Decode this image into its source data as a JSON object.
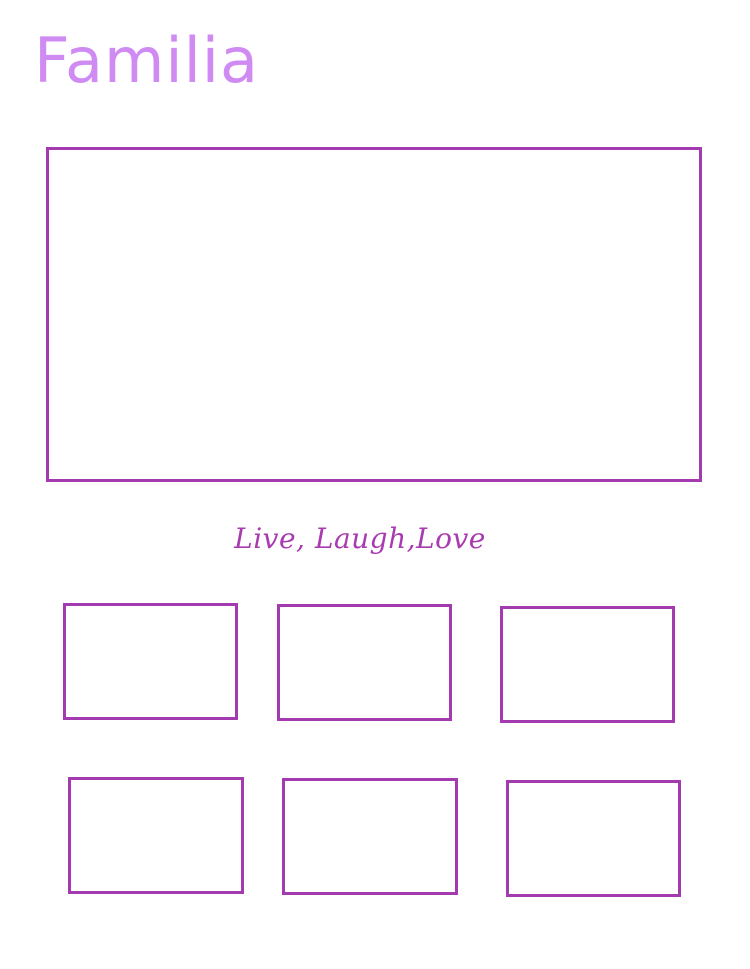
{
  "page": {
    "title": "Familia",
    "tagline": "Live, Laugh,Love"
  },
  "colors": {
    "title": "#d08bf2",
    "frame_border": "#a43ab0",
    "tagline": "#a93bb0",
    "background": "#ffffff"
  },
  "photo_slots": {
    "large_count": 1,
    "small_count": 6
  }
}
